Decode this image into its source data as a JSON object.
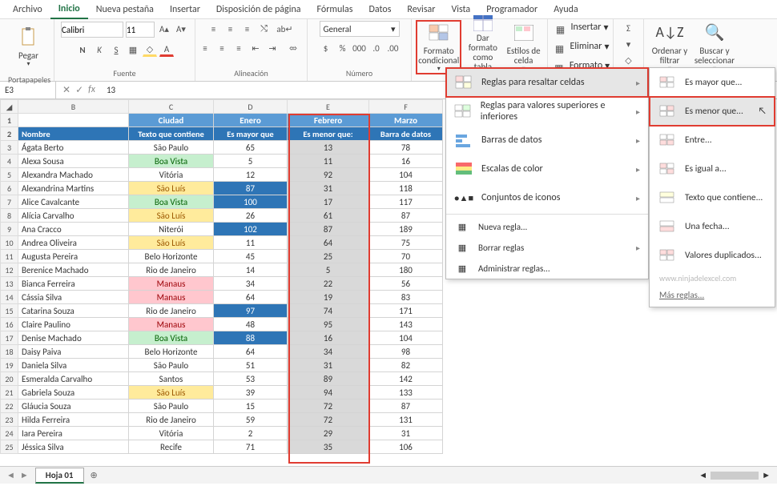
{
  "tabs": [
    "Archivo",
    "Inicio",
    "Nueva pestaña",
    "Insertar",
    "Disposición de página",
    "Fórmulas",
    "Datos",
    "Revisar",
    "Vista",
    "Programador",
    "Ayuda"
  ],
  "active_tab": 1,
  "ribbon": {
    "paste": "Pegar",
    "g_portapapeles": "Portapapeles",
    "font_name": "Calibri",
    "font_size": "11",
    "g_fuente": "Fuente",
    "g_alineacion": "Alineación",
    "number_format": "General",
    "g_numero": "Número",
    "cond_fmt": "Formato condicional",
    "fmt_tabla": "Dar formato como tabla",
    "estilos": "Estilos de celda",
    "insertar": "Insertar",
    "eliminar": "Eliminar",
    "formato": "Formato",
    "ordenar": "Ordenar y filtrar",
    "buscar": "Buscar y seleccionar"
  },
  "menu1": {
    "items": [
      "Reglas para resaltar celdas",
      "Reglas para valores superiores e inferiores",
      "Barras de datos",
      "Escalas de color",
      "Conjuntos de iconos"
    ],
    "new_rule": "Nueva regla...",
    "clear": "Borrar reglas",
    "manage": "Administrar reglas..."
  },
  "menu2": {
    "items": [
      "Es mayor que...",
      "Es menor que...",
      "Entre...",
      "Es igual a...",
      "Texto que contiene...",
      "Una fecha...",
      "Valores duplicados..."
    ],
    "watermark": "www.ninjadelexcel.com",
    "more": "Más reglas..."
  },
  "namebox": "E3",
  "formula": "13",
  "columns": [
    "B",
    "C",
    "D",
    "E",
    "F"
  ],
  "hdr1": {
    "city": "Ciudad",
    "enero": "Enero",
    "febrero": "Febrero",
    "marzo": "Marzo"
  },
  "hdr2": {
    "nombre": "Nombre",
    "city": "Texto que contiene",
    "enero": "Es mayor que",
    "febrero": "Es menor que:",
    "marzo": "Barra de datos"
  },
  "rows": [
    {
      "r": 3,
      "n": "Ágata Berto",
      "c": "São Paulo",
      "cc": "",
      "e": 65,
      "ec": "",
      "f": 13,
      "m": 78
    },
    {
      "r": 4,
      "n": "Alexa Sousa",
      "c": "Boa Vista",
      "cc": "green",
      "e": 5,
      "ec": "",
      "f": 11,
      "m": 16
    },
    {
      "r": 5,
      "n": "Alexandra Machado",
      "c": "Vitória",
      "cc": "",
      "e": 12,
      "ec": "",
      "f": 92,
      "m": 104
    },
    {
      "r": 6,
      "n": "Alexandrina Martins",
      "c": "São Luís",
      "cc": "yellow",
      "e": 87,
      "ec": "blue",
      "f": 31,
      "m": 118
    },
    {
      "r": 7,
      "n": "Alice Cavalcante",
      "c": "Boa Vista",
      "cc": "green",
      "e": 100,
      "ec": "blue",
      "f": 17,
      "m": 117
    },
    {
      "r": 8,
      "n": "Alícia Carvalho",
      "c": "São Luís",
      "cc": "yellow",
      "e": 26,
      "ec": "",
      "f": 61,
      "m": 87
    },
    {
      "r": 9,
      "n": "Ana Cracco",
      "c": "Niterói",
      "cc": "",
      "e": 102,
      "ec": "blue",
      "f": 87,
      "m": 189
    },
    {
      "r": 10,
      "n": "Andrea Oliveira",
      "c": "São Luís",
      "cc": "yellow",
      "e": 11,
      "ec": "",
      "f": 64,
      "m": 75
    },
    {
      "r": 11,
      "n": "Augusta Pereira",
      "c": "Belo Horizonte",
      "cc": "",
      "e": 45,
      "ec": "",
      "f": 25,
      "m": 70
    },
    {
      "r": 12,
      "n": "Berenice Machado",
      "c": "Rio de Janeiro",
      "cc": "",
      "e": 14,
      "ec": "",
      "f": 5,
      "m": 180
    },
    {
      "r": 13,
      "n": "Bianca Ferreira",
      "c": "Manaus",
      "cc": "pink",
      "e": 34,
      "ec": "",
      "f": 22,
      "m": 56
    },
    {
      "r": 14,
      "n": "Cássia Silva",
      "c": "Manaus",
      "cc": "pink",
      "e": 64,
      "ec": "",
      "f": 19,
      "m": 83
    },
    {
      "r": 15,
      "n": "Catarina Souza",
      "c": "Rio de Janeiro",
      "cc": "",
      "e": 97,
      "ec": "blue",
      "f": 74,
      "m": 171
    },
    {
      "r": 16,
      "n": "Claire Paulino",
      "c": "Manaus",
      "cc": "pink",
      "e": 48,
      "ec": "",
      "f": 95,
      "m": 143
    },
    {
      "r": 17,
      "n": "Denise Machado",
      "c": "Boa Vista",
      "cc": "green",
      "e": 88,
      "ec": "blue",
      "f": 16,
      "m": 104
    },
    {
      "r": 18,
      "n": "Daisy Paiva",
      "c": "Belo Horizonte",
      "cc": "",
      "e": 64,
      "ec": "",
      "f": 34,
      "m": 98
    },
    {
      "r": 19,
      "n": "Daniela Silva",
      "c": "São Paulo",
      "cc": "",
      "e": 51,
      "ec": "",
      "f": 31,
      "m": 82
    },
    {
      "r": 20,
      "n": "Esmeralda Carvalho",
      "c": "Santos",
      "cc": "",
      "e": 53,
      "ec": "",
      "f": 89,
      "m": 142
    },
    {
      "r": 21,
      "n": "Gabriela Souza",
      "c": "São Luís",
      "cc": "yellow",
      "e": 39,
      "ec": "",
      "f": 94,
      "m": 133
    },
    {
      "r": 22,
      "n": "Gláucia Souza",
      "c": "São Paulo",
      "cc": "",
      "e": 15,
      "ec": "",
      "f": 72,
      "m": 87
    },
    {
      "r": 23,
      "n": "Hilda Ferreira",
      "c": "Rio de Janeiro",
      "cc": "",
      "e": 59,
      "ec": "",
      "f": 72,
      "m": 131
    },
    {
      "r": 24,
      "n": "Iara Pereira",
      "c": "Vitória",
      "cc": "",
      "e": 2,
      "ec": "",
      "f": 29,
      "m": 31
    },
    {
      "r": 25,
      "n": "Jéssica Silva",
      "c": "Recife",
      "cc": "",
      "e": 71,
      "ec": "",
      "f": 35,
      "m": 106
    }
  ],
  "sheet_tab": "Hoja 01"
}
